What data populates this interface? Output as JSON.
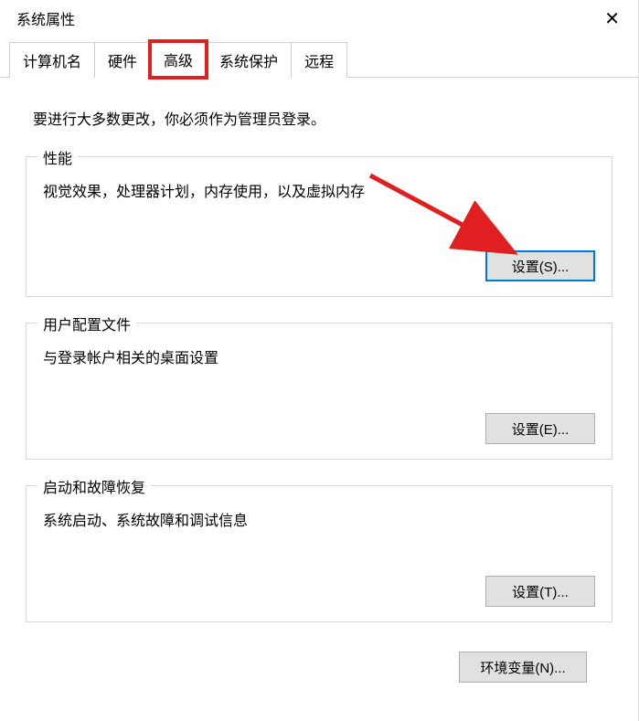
{
  "window": {
    "title": "系统属性"
  },
  "tabs": {
    "computer_name": "计算机名",
    "hardware": "硬件",
    "advanced": "高级",
    "system_protection": "系统保护",
    "remote": "远程"
  },
  "content": {
    "admin_note": "要进行大多数更改，你必须作为管理员登录。"
  },
  "performance": {
    "legend": "性能",
    "desc": "视觉效果，处理器计划，内存使用，以及虚拟内存",
    "settings_btn": "设置(S)..."
  },
  "user_profiles": {
    "legend": "用户配置文件",
    "desc": "与登录帐户相关的桌面设置",
    "settings_btn": "设置(E)..."
  },
  "startup_recovery": {
    "legend": "启动和故障恢复",
    "desc": "系统启动、系统故障和调试信息",
    "settings_btn": "设置(T)..."
  },
  "env_vars_btn": "环境变量(N)...",
  "annotation": {
    "arrow_color": "#e02020"
  }
}
